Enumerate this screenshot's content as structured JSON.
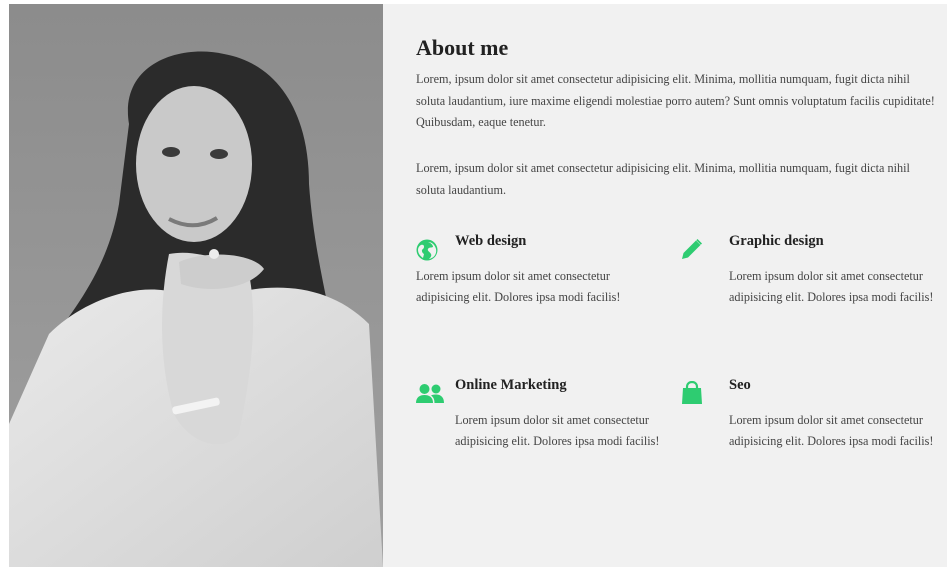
{
  "about": {
    "title": "About me",
    "paragraphs": [
      "Lorem, ipsum dolor sit amet consectetur adipisicing elit. Minima, mollitia numquam, fugit dicta nihil soluta laudantium, iure maxime eligendi molestiae porro autem? Sunt omnis voluptatum facilis cupiditate! Quibusdam, eaque tenetur.",
      "Lorem, ipsum dolor sit amet consectetur adipisicing elit. Minima, mollitia numquam, fugit dicta nihil soluta laudantium."
    ]
  },
  "services": [
    {
      "icon": "globe-icon",
      "title": "Web design",
      "description": "Lorem ipsum dolor sit amet consectetur adipisicing elit. Dolores ipsa modi facilis!"
    },
    {
      "icon": "pencil-icon",
      "title": "Graphic design",
      "description": "Lorem ipsum dolor sit amet consectetur adipisicing elit. Dolores ipsa modi facilis!"
    },
    {
      "icon": "users-icon",
      "title": "Online Marketing",
      "description": "Lorem ipsum dolor sit amet consectetur adipisicing elit. Dolores ipsa modi facilis!"
    },
    {
      "icon": "shopping-bag-icon",
      "title": "Seo",
      "description": "Lorem ipsum dolor sit amet consectetur adipisicing elit. Dolores ipsa modi facilis!"
    }
  ],
  "colors": {
    "accent": "#2ecc71",
    "background": "#f1f1f1",
    "text": "#444444"
  }
}
